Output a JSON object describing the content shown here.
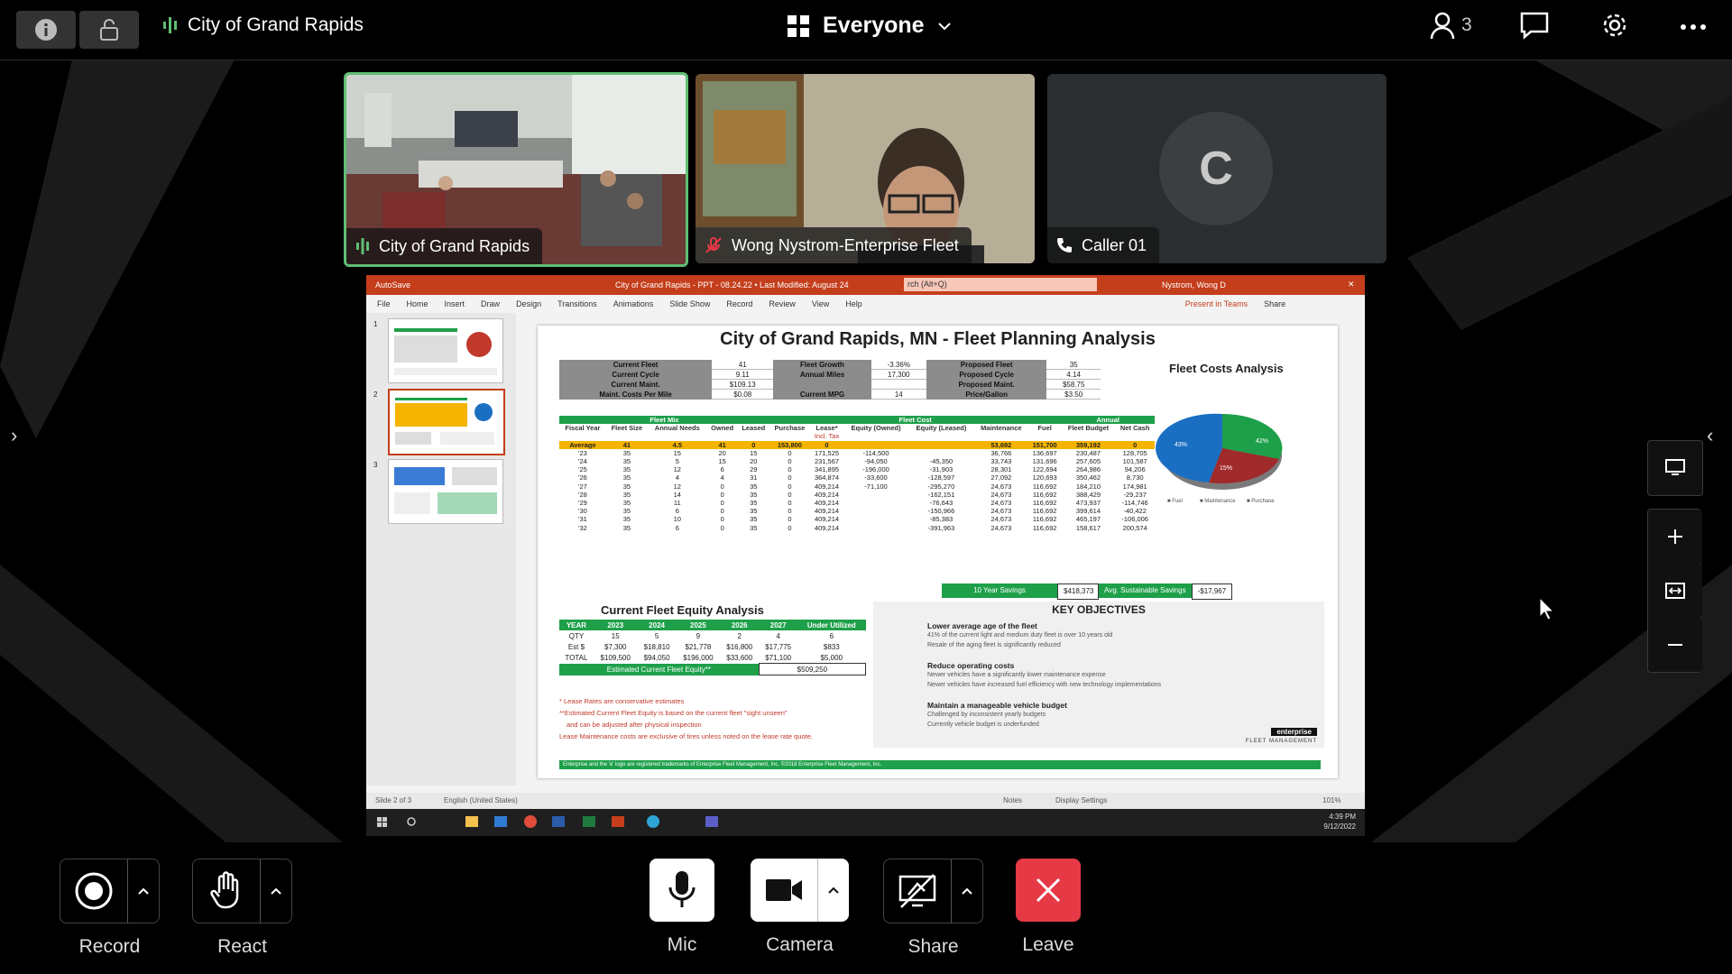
{
  "topbar": {
    "meeting_title": "City of Grand Rapids",
    "view_label": "Everyone",
    "participant_count": "3"
  },
  "tiles": [
    {
      "name": "City of Grand Rapids"
    },
    {
      "name": "Wong Nystrom-Enterprise Fleet"
    },
    {
      "name": "Caller 01",
      "initial": "C"
    }
  ],
  "presentation": {
    "window_title": "City of Grand Rapids - PPT - 08.24.22 • Last Modified: August 24",
    "autosave": "AutoSave",
    "search": "rch (Alt+Q)",
    "user": "Nystrom, Wong D",
    "present_in_teams": "Present in Teams",
    "share": "Share",
    "menu": [
      "File",
      "Home",
      "Insert",
      "Draw",
      "Design",
      "Transitions",
      "Animations",
      "Slide Show",
      "Record",
      "Review",
      "View",
      "Help"
    ],
    "slide_numbers": [
      "1",
      "2",
      "3"
    ],
    "status_left": "Slide 2 of 3",
    "status_lang": "English (United States)",
    "status_notes": "Notes",
    "status_display": "Display Settings",
    "zoom": "101%",
    "clock_time": "4:39 PM",
    "clock_date": "9/12/2022",
    "slide": {
      "title": "City of Grand Rapids, MN - Fleet Planning Analysis",
      "chart_title": "Fleet Costs Analysis",
      "kv_rows": [
        [
          "Current Fleet",
          "41",
          "Fleet Growth",
          "-3.36%",
          "Proposed Fleet",
          "35"
        ],
        [
          "Current Cycle",
          "9.11",
          "Annual Miles",
          "17,300",
          "Proposed Cycle",
          "4.14"
        ],
        [
          "Current Maint.",
          "$109.13",
          "",
          "",
          "Proposed Maint.",
          "$58.75"
        ],
        [
          "Maint. Costs Per Mile",
          "$0.08",
          "Current MPG",
          "14",
          "Price/Gallon",
          "$3.50"
        ]
      ],
      "group_headers": [
        "Fleet Mix",
        "Fleet Cost",
        "Annual"
      ],
      "columns": [
        "Fiscal Year",
        "Fleet Size",
        "Annual Needs",
        "Owned",
        "Leased",
        "Purchase",
        "Lease*",
        "Equity (Owned)",
        "Equity (Leased)",
        "Maintenance",
        "Fuel",
        "Fleet Budget",
        "Net Cash"
      ],
      "incl_tax": "Incl. Tax",
      "average_row": [
        "Average",
        "41",
        "4.5",
        "41",
        "0",
        "153,800",
        "0",
        "",
        "",
        "53,692",
        "151,700",
        "359,192",
        "0"
      ],
      "rows": [
        [
          "'23",
          "35",
          "15",
          "20",
          "15",
          "0",
          "171,525",
          "-114,500",
          "",
          "36,766",
          "136,697",
          "230,487",
          "128,705"
        ],
        [
          "'24",
          "35",
          "5",
          "15",
          "20",
          "0",
          "231,567",
          "-94,050",
          "-45,350",
          "33,743",
          "131,696",
          "257,605",
          "101,587"
        ],
        [
          "'25",
          "35",
          "12",
          "6",
          "29",
          "0",
          "341,895",
          "-196,000",
          "-31,903",
          "28,301",
          "122,694",
          "264,986",
          "94,206"
        ],
        [
          "'26",
          "35",
          "4",
          "4",
          "31",
          "0",
          "364,874",
          "-33,600",
          "-128,597",
          "27,092",
          "120,693",
          "350,462",
          "8,730"
        ],
        [
          "'27",
          "35",
          "12",
          "0",
          "35",
          "0",
          "409,214",
          "-71,100",
          "-295,270",
          "24,673",
          "116,692",
          "184,210",
          "174,981"
        ],
        [
          "'28",
          "35",
          "14",
          "0",
          "35",
          "0",
          "409,214",
          "",
          "-162,151",
          "24,673",
          "116,692",
          "388,429",
          "-29,237"
        ],
        [
          "'29",
          "35",
          "11",
          "0",
          "35",
          "0",
          "409,214",
          "",
          "-76,643",
          "24,673",
          "116,692",
          "473,937",
          "-114,746"
        ],
        [
          "'30",
          "35",
          "6",
          "0",
          "35",
          "0",
          "409,214",
          "",
          "-150,966",
          "24,673",
          "116,692",
          "399,614",
          "-40,422"
        ],
        [
          "'31",
          "35",
          "10",
          "0",
          "35",
          "0",
          "409,214",
          "",
          "-85,383",
          "24,673",
          "116,692",
          "465,197",
          "-106,006"
        ],
        [
          "'32",
          "35",
          "6",
          "0",
          "35",
          "0",
          "409,214",
          "",
          "-391,963",
          "24,673",
          "116,692",
          "158,617",
          "200,574"
        ]
      ],
      "savings_label": "10 Year Savings",
      "savings_value": "$418,373",
      "avg_savings_label": "Avg. Sustainable Savings",
      "avg_savings_value": "-$17,967",
      "pie_labels": [
        "43%",
        "42%",
        "15%"
      ],
      "legend": [
        "Fuel",
        "Maintenance",
        "Purchase"
      ],
      "equity_title": "Current Fleet Equity Analysis",
      "equity_header": [
        "YEAR",
        "2023",
        "2024",
        "2025",
        "2026",
        "2027",
        "Under Utilized"
      ],
      "equity_rows": [
        [
          "QTY",
          "15",
          "5",
          "9",
          "2",
          "4",
          "6"
        ],
        [
          "Est $",
          "$7,300",
          "$18,810",
          "$21,778",
          "$16,800",
          "$17,775",
          "$833"
        ],
        [
          "TOTAL",
          "$109,500",
          "$94,050",
          "$196,000",
          "$33,600",
          "$71,100",
          "$5,000"
        ]
      ],
      "equity_total_label": "Estimated Current Fleet Equity**",
      "equity_total_value": "$509,250",
      "notes": [
        "* Lease Rates are conservative estimates",
        "**Estimated Current Fleet Equity is based on the current fleet \"sight unseen\"",
        "and can be adjusted after physical inspection",
        "Lease Maintenance costs are exclusive of tires unless noted on the lease rate quote."
      ],
      "objectives_title": "KEY OBJECTIVES",
      "objectives": [
        {
          "h": "Lower average age of the fleet",
          "d": [
            "41% of the current light and medium duty fleet is over 10 years old",
            "Resale of the aging fleet is significantly reduced"
          ]
        },
        {
          "h": "Reduce operating costs",
          "d": [
            "Newer vehicles have a significantly lower maintenance expense",
            "Newer vehicles have increased fuel efficiency with new technology implementations"
          ]
        },
        {
          "h": "Maintain a manageable vehicle budget",
          "d": [
            "Challenged by inconsistent yearly budgets",
            "Currently vehicle budget is underfunded"
          ]
        }
      ],
      "brand": "enterprise",
      "brand_sub": "FLEET MANAGEMENT",
      "footer": "Enterprise and the 'e' logo are registered trademarks of Enterprise Fleet Management, Inc. ©2018 Enterprise Fleet Management, Inc."
    }
  },
  "controls": {
    "record": "Record",
    "react": "React",
    "mic": "Mic",
    "camera": "Camera",
    "share": "Share",
    "leave": "Leave"
  },
  "colors": {
    "accent_green": "#5fbf73",
    "leave_red": "#e63946",
    "ppt_red": "#c43e1c",
    "slide_green": "#1ea04a",
    "slide_amber": "#f5b400"
  }
}
